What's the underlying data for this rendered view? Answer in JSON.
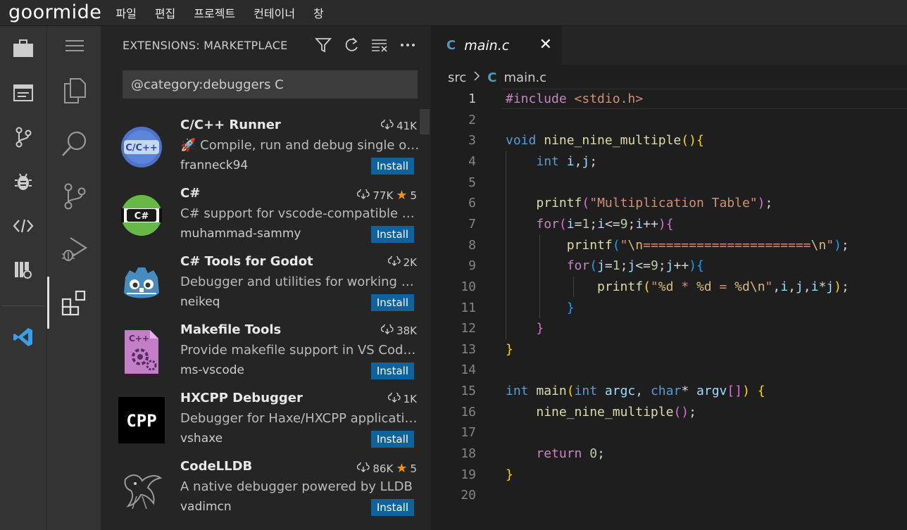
{
  "topbar": {
    "logo": "goormide",
    "menu": [
      "파일",
      "편집",
      "프로젝트",
      "컨테이너",
      "창"
    ]
  },
  "outer_bar": {
    "icons": [
      "briefcase-icon",
      "window-icon",
      "git-branch-icon",
      "bug-icon",
      "code-icon",
      "book-link-icon",
      "vscode-logo-icon"
    ]
  },
  "activity_bar": {
    "icons": [
      "menu-icon",
      "files-icon",
      "search-icon",
      "source-control-icon",
      "run-debug-icon",
      "extensions-icon"
    ]
  },
  "sidebar": {
    "title": "EXTENSIONS: MARKETPLACE",
    "actions": [
      "filter-icon",
      "refresh-icon",
      "clear-icon",
      "more-icon"
    ],
    "search_value": "@category:debuggers C",
    "extensions": [
      {
        "name": "C/C++ Runner",
        "downloads": "41K",
        "rating": "",
        "desc": "🚀 Compile, run and debug single or multiple C/C++ files",
        "publisher": "franneck94",
        "install": "Install",
        "icon": "c-cpp-icon"
      },
      {
        "name": "C#",
        "downloads": "77K",
        "rating": "5",
        "desc": "C# support for vscode-compatible editors",
        "publisher": "muhammad-sammy",
        "install": "Install",
        "icon": "csharp-icon"
      },
      {
        "name": "C# Tools for Godot",
        "downloads": "2K",
        "rating": "",
        "desc": "Debugger and utilities for working with Godot C# projects",
        "publisher": "neikeq",
        "install": "Install",
        "icon": "godot-icon"
      },
      {
        "name": "Makefile Tools",
        "downloads": "38K",
        "rating": "",
        "desc": "Provide makefile support in VS Code: C/C++ IntelliSense",
        "publisher": "ms-vscode",
        "install": "Install",
        "icon": "makefile-icon"
      },
      {
        "name": "HXCPP Debugger",
        "downloads": "1K",
        "rating": "",
        "desc": "Debugger for Haxe/HXCPP applications",
        "publisher": "vshaxe",
        "install": "Install",
        "icon": "cpp-icon"
      },
      {
        "name": "CodeLLDB",
        "downloads": "86K",
        "rating": "5",
        "desc": "A native debugger powered by LLDB",
        "publisher": "vadimcn",
        "install": "Install",
        "icon": "dragon-icon"
      }
    ]
  },
  "editor": {
    "tab": {
      "lang": "C",
      "label": "main.c"
    },
    "breadcrumb": {
      "folder": "src",
      "lang": "C",
      "file": "main.c"
    },
    "line_numbers": [
      "1",
      "2",
      "3",
      "4",
      "5",
      "6",
      "7",
      "8",
      "9",
      "10",
      "11",
      "12",
      "13",
      "14",
      "15",
      "16",
      "17",
      "18",
      "19",
      "20"
    ],
    "lines": [
      [
        [
          "ctl",
          "#include"
        ],
        [
          "",
          "&nbsp;"
        ],
        [
          "str",
          "<stdio.h>"
        ]
      ],
      [],
      [
        [
          "kw",
          "void"
        ],
        [
          "",
          "&nbsp;"
        ],
        [
          "fn",
          "nine_nine_multiple"
        ],
        [
          "b1",
          "()"
        ],
        [
          "b1",
          "{"
        ]
      ],
      [
        [
          "",
          "    "
        ],
        [
          "kw",
          "int"
        ],
        [
          "",
          "&nbsp;"
        ],
        [
          "var",
          "i"
        ],
        [
          "",
          ","
        ],
        [
          "var",
          "j"
        ],
        [
          "",
          ";"
        ]
      ],
      [],
      [
        [
          "",
          "    "
        ],
        [
          "fn",
          "printf"
        ],
        [
          "b2",
          "("
        ],
        [
          "str",
          "\"Multiplication Table\""
        ],
        [
          "b2",
          ")"
        ],
        [
          "",
          ";"
        ]
      ],
      [
        [
          "",
          "    "
        ],
        [
          "ctl",
          "for"
        ],
        [
          "b2",
          "("
        ],
        [
          "var",
          "i"
        ],
        [
          "",
          "="
        ],
        [
          "num",
          "1"
        ],
        [
          "",
          ";"
        ],
        [
          "var",
          "i"
        ],
        [
          "",
          "<="
        ],
        [
          "num",
          "9"
        ],
        [
          "",
          ";"
        ],
        [
          "var",
          "i"
        ],
        [
          "",
          "++"
        ],
        [
          "b2",
          ")"
        ],
        [
          "b2",
          "{"
        ]
      ],
      [
        [
          "",
          "        "
        ],
        [
          "fn",
          "printf"
        ],
        [
          "b3",
          "("
        ],
        [
          "str",
          "\""
        ],
        [
          "esc",
          "\\n"
        ],
        [
          "str",
          "======================"
        ],
        [
          "esc",
          "\\n"
        ],
        [
          "str",
          "\""
        ],
        [
          "b3",
          ")"
        ],
        [
          "",
          ";"
        ]
      ],
      [
        [
          "",
          "        "
        ],
        [
          "ctl",
          "for"
        ],
        [
          "b3",
          "("
        ],
        [
          "var",
          "j"
        ],
        [
          "",
          "="
        ],
        [
          "num",
          "1"
        ],
        [
          "",
          ";"
        ],
        [
          "var",
          "j"
        ],
        [
          "",
          "<="
        ],
        [
          "num",
          "9"
        ],
        [
          "",
          ";"
        ],
        [
          "var",
          "j"
        ],
        [
          "",
          "++"
        ],
        [
          "b3",
          ")"
        ],
        [
          "b3",
          "{"
        ]
      ],
      [
        [
          "",
          "            "
        ],
        [
          "fn",
          "printf"
        ],
        [
          "b1",
          "("
        ],
        [
          "str",
          "\""
        ],
        [
          "esc",
          "%d"
        ],
        [
          "str",
          " * "
        ],
        [
          "esc",
          "%d"
        ],
        [
          "str",
          " = "
        ],
        [
          "esc",
          "%d"
        ],
        [
          "esc",
          "\\n"
        ],
        [
          "str",
          "\""
        ],
        [
          "",
          ","
        ],
        [
          "var",
          "i"
        ],
        [
          "",
          ","
        ],
        [
          "var",
          "j"
        ],
        [
          "",
          ","
        ],
        [
          "var",
          "i"
        ],
        [
          "",
          "*"
        ],
        [
          "var",
          "j"
        ],
        [
          "b1",
          ")"
        ],
        [
          "",
          ";"
        ]
      ],
      [
        [
          "",
          "        "
        ],
        [
          "b3",
          "}"
        ]
      ],
      [
        [
          "",
          "    "
        ],
        [
          "b2",
          "}"
        ]
      ],
      [
        [
          "b1",
          "}"
        ]
      ],
      [],
      [
        [
          "kw",
          "int"
        ],
        [
          "",
          "&nbsp;"
        ],
        [
          "fn",
          "main"
        ],
        [
          "b1",
          "("
        ],
        [
          "kw",
          "int"
        ],
        [
          "",
          "&nbsp;"
        ],
        [
          "var",
          "argc"
        ],
        [
          "",
          ", "
        ],
        [
          "kw",
          "char"
        ],
        [
          "",
          "* "
        ],
        [
          "var",
          "argv"
        ],
        [
          "b2",
          "[]"
        ],
        [
          "b1",
          ")"
        ],
        [
          "",
          " "
        ],
        [
          "b1",
          "{"
        ]
      ],
      [
        [
          "",
          "    "
        ],
        [
          "fn",
          "nine_nine_multiple"
        ],
        [
          "b2",
          "()"
        ],
        [
          "",
          ";"
        ]
      ],
      [],
      [
        [
          "",
          "    "
        ],
        [
          "ctl",
          "return"
        ],
        [
          "",
          " "
        ],
        [
          "num",
          "0"
        ],
        [
          "",
          ";"
        ]
      ],
      [
        [
          "b1",
          "}"
        ]
      ],
      []
    ]
  }
}
